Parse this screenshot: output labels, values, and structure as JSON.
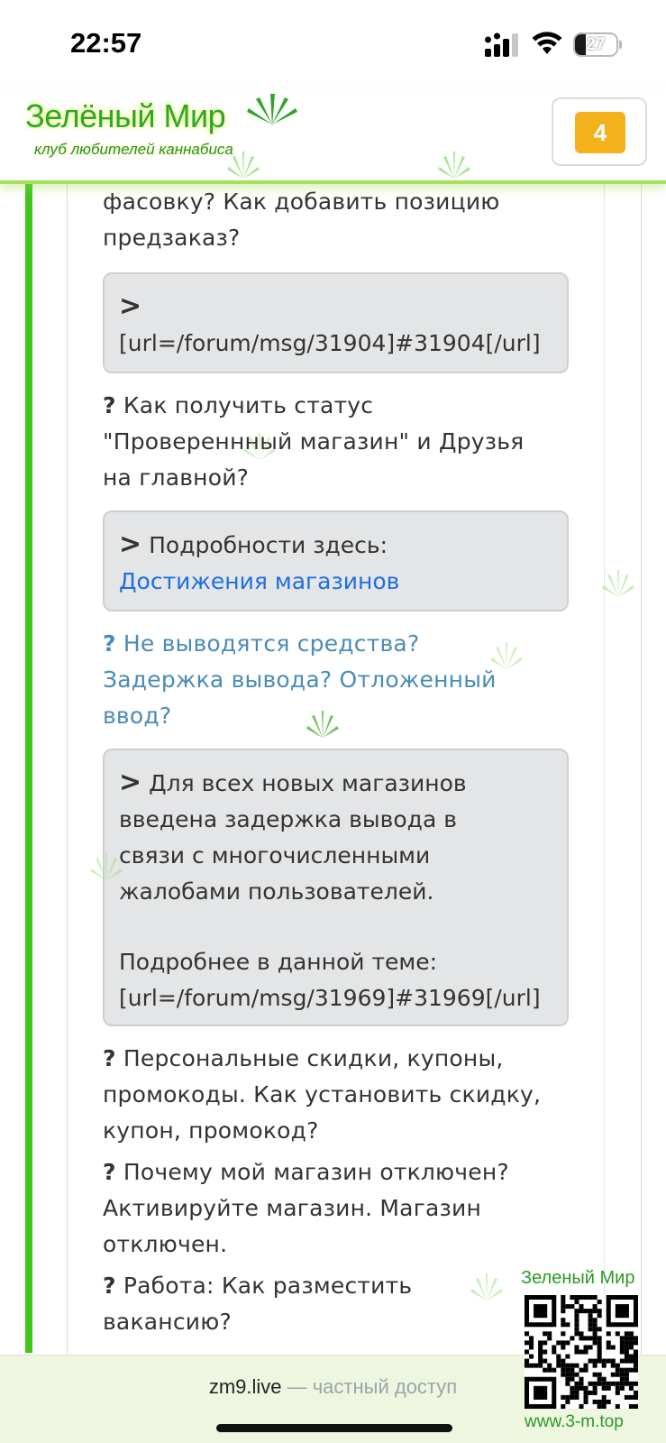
{
  "status_bar": {
    "time": "22:57",
    "battery_level": "27",
    "battery_fraction": 0.27
  },
  "header": {
    "logo_title": "Зелёный Мир",
    "logo_subtitle": "клуб любителей каннабиса",
    "cart_count": "4",
    "accent_color": "#3fc61a",
    "badge_color": "#f3b21c"
  },
  "content": {
    "intro_line1": "фасовку? Как добавить позицию",
    "intro_line2": "предзаказ?",
    "answer1": {
      "marker": ">",
      "line1": "[url=/forum/msg/31904]#31904[/url]"
    },
    "q2": {
      "marker": "?",
      "line1": "Как получить статус",
      "line2": "\"Провереннный магазин\" и Друзья",
      "line3": "на главной?"
    },
    "answer2": {
      "marker": ">",
      "text": "Подробности здесь:",
      "link": "Достижения магазинов"
    },
    "q3": {
      "marker": "?",
      "line1": "Не выводятся средства?",
      "line2": "Задержка вывода? Отложенный",
      "line3": "ввод?"
    },
    "answer3": {
      "marker": ">",
      "line1": "Для всех новых магазинов",
      "line2": "введена задержка вывода в",
      "line3": "связи с многочисленными",
      "line4": "жалобами пользователей.",
      "line5": "Подробнее в данной теме:",
      "line6": "[url=/forum/msg/31969]#31969[/url]"
    },
    "q4": {
      "marker": "?",
      "line1": "Персональные скидки, купоны,",
      "line2": "промокоды. Как установить скидку,",
      "line3": "купон, промокод?"
    },
    "q5": {
      "marker": "?",
      "line1": "Почему мой магазин отключен?",
      "line2": "Активируйте магазин. Магазин",
      "line3": "отключен."
    },
    "q6": {
      "marker": "?",
      "line1": "Работа: Как разместить",
      "line2": "вакансию?"
    }
  },
  "footer": {
    "domain": "zm9.live",
    "note": " — частный доступ"
  },
  "qr": {
    "title": "Зеленый Мир",
    "url": "www.3-m.top"
  },
  "icons": [
    "cannabis-leaf-icon",
    "signal-icon",
    "wifi-icon",
    "battery-icon",
    "qr-code-icon"
  ]
}
